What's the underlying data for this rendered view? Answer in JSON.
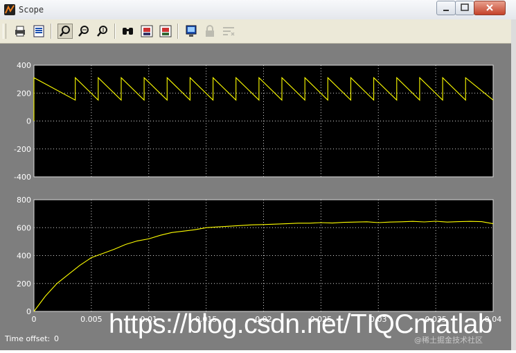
{
  "window": {
    "title": "Scope",
    "icon": "matlab-scope-icon"
  },
  "toolbar": {
    "buttons": [
      {
        "name": "print-icon",
        "enabled": true
      },
      {
        "name": "parameters-icon",
        "enabled": true
      },
      {
        "name": "zoom-icon",
        "enabled": true,
        "pressed": true
      },
      {
        "name": "zoom-x-icon",
        "enabled": true
      },
      {
        "name": "zoom-y-icon",
        "enabled": true
      },
      {
        "name": "autoscale-icon",
        "enabled": true
      },
      {
        "name": "save-axes-icon",
        "enabled": true
      },
      {
        "name": "restore-axes-icon",
        "enabled": true
      },
      {
        "name": "floating-scope-icon",
        "enabled": true
      },
      {
        "name": "lock-axes-icon",
        "enabled": false
      },
      {
        "name": "signal-selection-icon",
        "enabled": false
      }
    ]
  },
  "footer": {
    "time_offset_label": "Time offset:",
    "time_offset_value": "0"
  },
  "watermark": {
    "url": "https://blog.csdn.net/TIQCmatlab",
    "secondary": "@稀土掘金技术社区"
  },
  "colors": {
    "background": "#7e7e7e",
    "plot_bg": "#000000",
    "trace": "#ffff00",
    "grid": "#ffffff"
  },
  "chart_data": [
    {
      "type": "line",
      "xlim": [
        0,
        0.04
      ],
      "ylim": [
        -400,
        400
      ],
      "yticks": [
        "400",
        "200",
        "0",
        "-200",
        "-400"
      ],
      "xticks": [],
      "grid": true,
      "series": [
        {
          "x": [
            0,
            0,
            0.0036,
            0.0036,
            0.0036,
            0.0056,
            0.0056,
            0.0056,
            0.0076,
            0.0076,
            0.0076,
            0.0096,
            0.0096,
            0.0096,
            0.0116,
            0.0116,
            0.0116,
            0.0136,
            0.0136,
            0.0136,
            0.0156,
            0.0156,
            0.0156,
            0.0176,
            0.0176,
            0.0176,
            0.0196,
            0.0196,
            0.0196,
            0.0216,
            0.0216,
            0.0216,
            0.0236,
            0.0236,
            0.0236,
            0.0256,
            0.0256,
            0.0256,
            0.0276,
            0.0276,
            0.0276,
            0.0296,
            0.0296,
            0.0296,
            0.0316,
            0.0316,
            0.0316,
            0.0336,
            0.0336,
            0.0336,
            0.0356,
            0.0356,
            0.0356,
            0.0376,
            0.0376,
            0.0376,
            0.04
          ],
          "y": [
            0,
            310,
            150,
            150,
            310,
            150,
            150,
            310,
            150,
            150,
            310,
            150,
            150,
            310,
            150,
            150,
            310,
            150,
            150,
            310,
            150,
            150,
            310,
            150,
            150,
            310,
            150,
            150,
            310,
            150,
            150,
            310,
            150,
            150,
            310,
            150,
            150,
            310,
            150,
            150,
            310,
            150,
            150,
            310,
            150,
            150,
            310,
            150,
            150,
            310,
            150,
            150,
            310,
            150,
            150,
            310,
            150
          ]
        }
      ]
    },
    {
      "type": "line",
      "xlim": [
        0,
        0.04
      ],
      "ylim": [
        0,
        800
      ],
      "yticks": [
        "800",
        "600",
        "400",
        "200",
        "0"
      ],
      "xticks": [
        "0",
        "0.005",
        "0.01",
        "0.015",
        "0.02",
        "0.025",
        "0.03",
        "0.035",
        "0.04"
      ],
      "grid": true,
      "series": [
        {
          "x": [
            0,
            0.001,
            0.002,
            0.003,
            0.004,
            0.005,
            0.006,
            0.007,
            0.008,
            0.009,
            0.01,
            0.011,
            0.012,
            0.013,
            0.014,
            0.015,
            0.016,
            0.017,
            0.018,
            0.019,
            0.02,
            0.021,
            0.022,
            0.023,
            0.024,
            0.025,
            0.026,
            0.027,
            0.028,
            0.029,
            0.03,
            0.031,
            0.032,
            0.033,
            0.034,
            0.035,
            0.036,
            0.037,
            0.038,
            0.039,
            0.04
          ],
          "y": [
            0,
            110,
            200,
            265,
            330,
            385,
            415,
            445,
            480,
            505,
            520,
            545,
            565,
            575,
            585,
            600,
            605,
            610,
            615,
            620,
            622,
            625,
            628,
            632,
            632,
            636,
            633,
            638,
            640,
            642,
            636,
            640,
            642,
            645,
            641,
            646,
            640,
            643,
            645,
            643,
            628
          ]
        }
      ]
    }
  ]
}
